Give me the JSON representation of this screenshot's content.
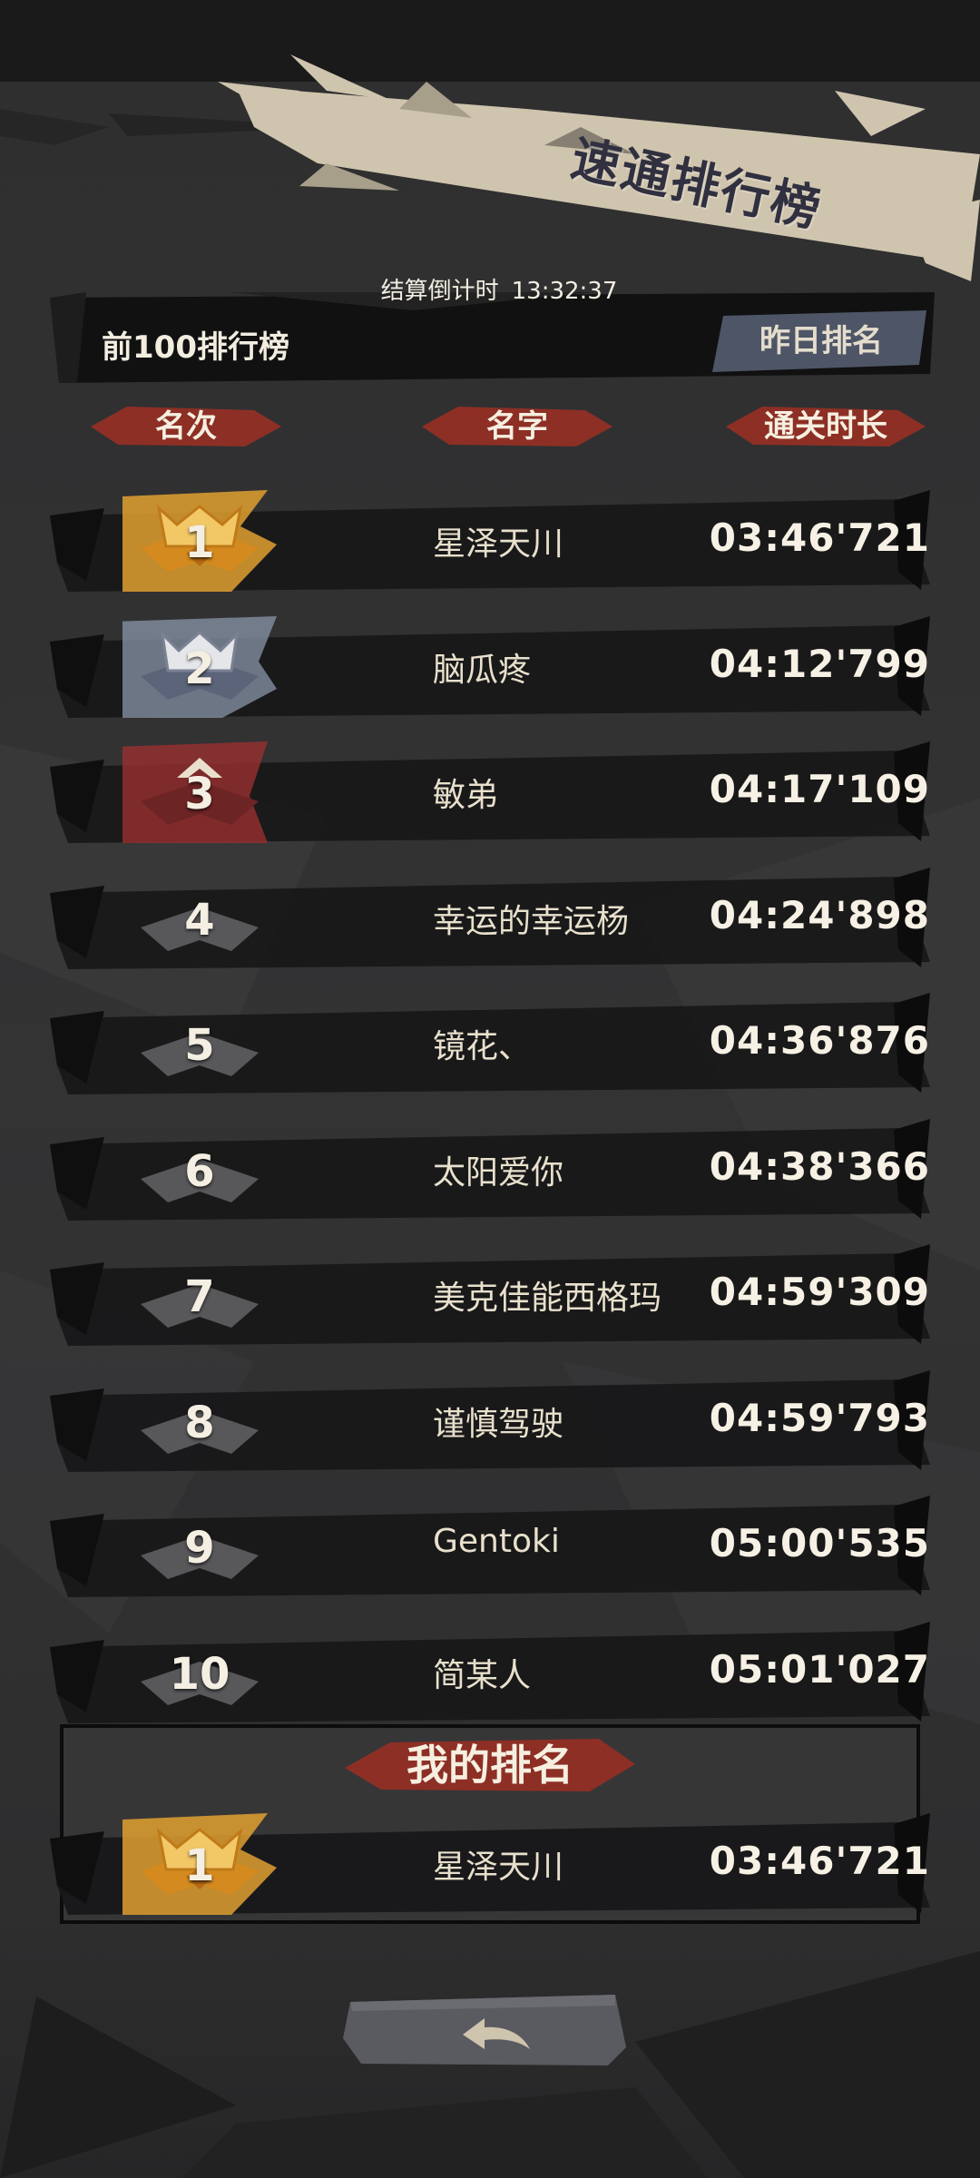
{
  "board": {
    "title": "速通排行榜",
    "countdown_label": "结算倒计时",
    "countdown_value": "13:32:37",
    "top100_label": "前100排行榜",
    "yesterday_button": "昨日排名"
  },
  "columns": {
    "rank": "名次",
    "name": "名字",
    "time": "通关时长"
  },
  "rows": [
    {
      "rank": "1",
      "name": "星泽天川",
      "time": "03:46'721",
      "tier": "gold"
    },
    {
      "rank": "2",
      "name": "脑瓜疼",
      "time": "04:12'799",
      "tier": "silver"
    },
    {
      "rank": "3",
      "name": "敏弟",
      "time": "04:17'109",
      "tier": "bronze"
    },
    {
      "rank": "4",
      "name": "幸运的幸运杨",
      "time": "04:24'898",
      "tier": "plain"
    },
    {
      "rank": "5",
      "name": "镜花、",
      "time": "04:36'876",
      "tier": "plain"
    },
    {
      "rank": "6",
      "name": "太阳爱你",
      "time": "04:38'366",
      "tier": "plain"
    },
    {
      "rank": "7",
      "name": "美克佳能西格玛",
      "time": "04:59'309",
      "tier": "plain"
    },
    {
      "rank": "8",
      "name": "谨慎驾驶",
      "time": "04:59'793",
      "tier": "plain"
    },
    {
      "rank": "9",
      "name": "Gentoki",
      "time": "05:00'535",
      "tier": "plain"
    },
    {
      "rank": "10",
      "name": "简某人",
      "time": "05:01'027",
      "tier": "plain"
    }
  ],
  "my_rank": {
    "title": "我的排名",
    "rank": "1",
    "name": "星泽天川",
    "time": "03:46'721",
    "tier": "gold"
  },
  "back_button": {
    "icon": "back-arrow-icon"
  },
  "colors": {
    "gold": "#e0a030",
    "silver": "#8a96a8",
    "bronze": "#9a3030",
    "plain": "#4a4a4c",
    "accent_red": "#a8382c",
    "banner": "#cfc4ad"
  }
}
